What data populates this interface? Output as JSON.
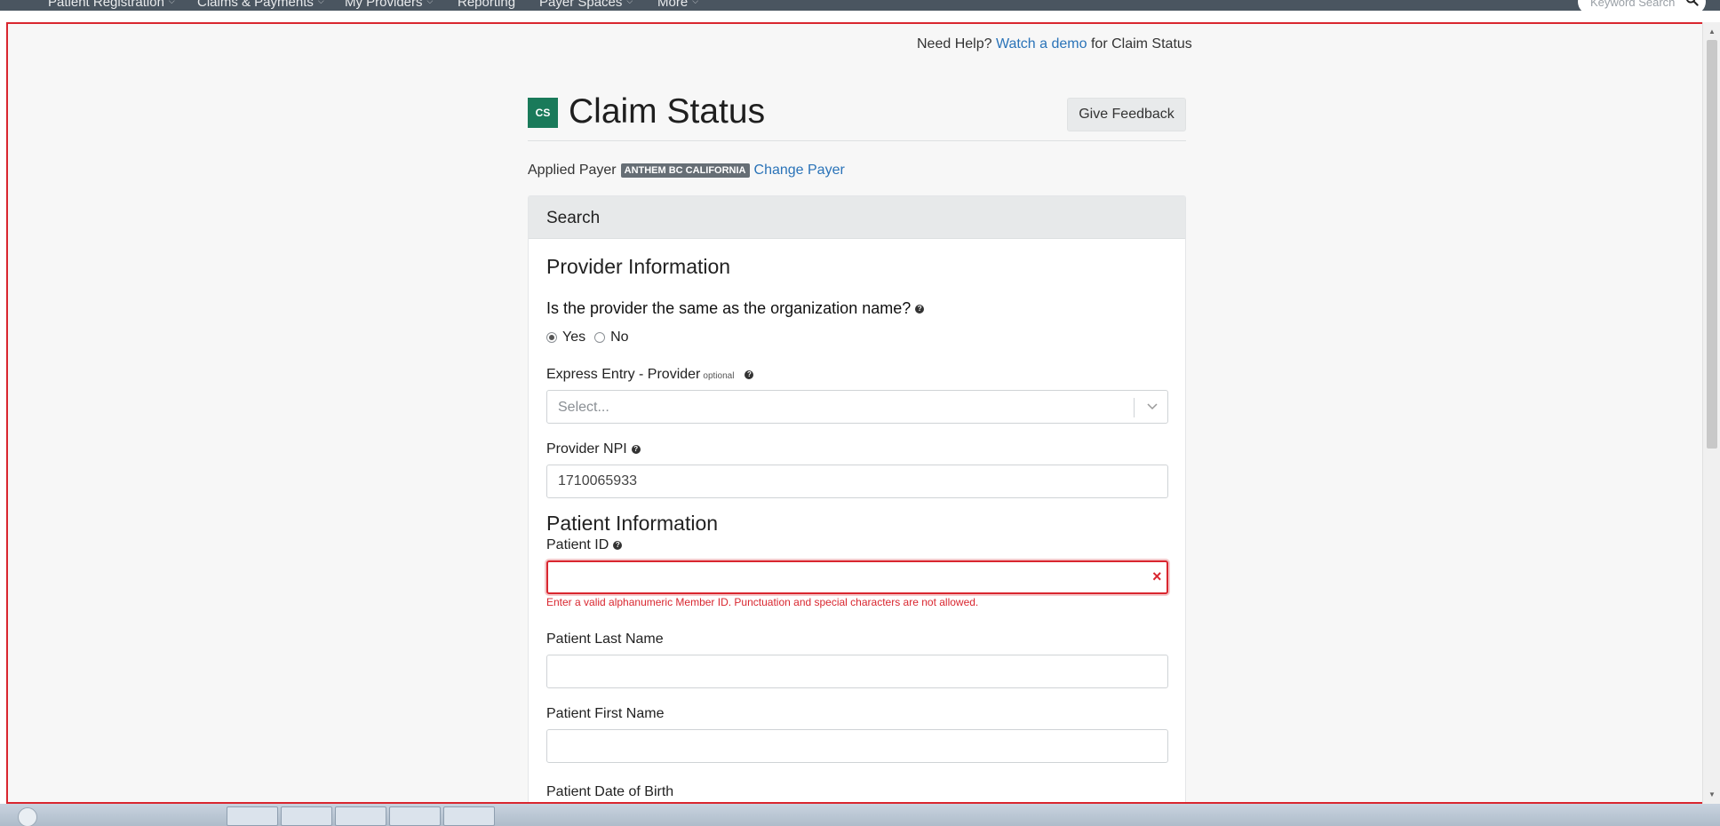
{
  "topnav": {
    "items": [
      {
        "label": "Patient Registration",
        "has_caret": true
      },
      {
        "label": "Claims & Payments",
        "has_caret": true
      },
      {
        "label": "My Providers",
        "has_caret": true
      },
      {
        "label": "Reporting",
        "has_caret": false
      },
      {
        "label": "Payer Spaces",
        "has_caret": true
      },
      {
        "label": "More",
        "has_caret": true
      }
    ],
    "search_placeholder": "Keyword Search",
    "search_icon": "search-icon"
  },
  "help": {
    "prefix": "Need Help?",
    "link": "Watch a demo",
    "suffix": "for Claim Status"
  },
  "header": {
    "badge": "CS",
    "title": "Claim Status",
    "feedback_button": "Give Feedback"
  },
  "payer": {
    "label": "Applied Payer",
    "name": "ANTHEM BC CALIFORNIA",
    "change_link": "Change Payer"
  },
  "card": {
    "header": "Search",
    "provider_section": {
      "title": "Provider Information",
      "question": "Is the provider the same as the organization name?",
      "options": [
        {
          "label": "Yes",
          "checked": true
        },
        {
          "label": "No",
          "checked": false
        }
      ],
      "express_entry_label": "Express Entry - Provider",
      "optional_tag": "optional",
      "express_entry_placeholder": "Select...",
      "npi_label": "Provider NPI",
      "npi_value": "1710065933"
    },
    "patient_section": {
      "title": "Patient Information",
      "patient_id_label": "Patient ID",
      "patient_id_value": "",
      "clear_symbol": "×",
      "patient_id_error": "Enter a valid alphanumeric Member ID. Punctuation and special characters are not allowed.",
      "last_name_label": "Patient Last Name",
      "last_name_value": "",
      "first_name_label": "Patient First Name",
      "first_name_value": "",
      "dob_label": "Patient Date of Birth"
    }
  },
  "colors": {
    "accent_link": "#2a73b8",
    "error": "#d9262f",
    "badge_green": "#1a7a5a",
    "nav_bg": "#4a5560"
  }
}
